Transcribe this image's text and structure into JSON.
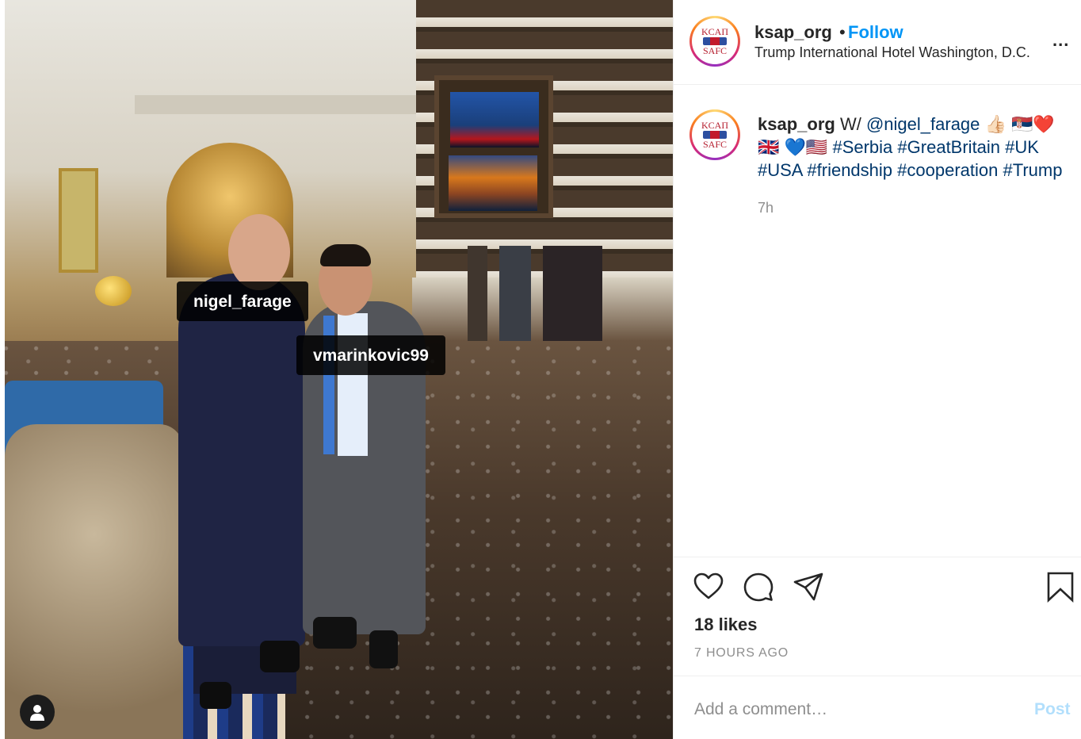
{
  "photo": {
    "tags": [
      "nigel_farage",
      "vmarinkovic99"
    ],
    "user_tag_icon": "person-icon"
  },
  "header": {
    "avatar_logo_top": "KCAΠ",
    "avatar_logo_bottom": "SAFC",
    "username": "ksap_org",
    "separator": "•",
    "follow_label": "Follow",
    "location": "Trump International Hotel Washington, D.C.",
    "more_icon": "more-options-icon",
    "more_label": "..."
  },
  "caption": {
    "username": "ksap_org",
    "text_prefix": "W/",
    "mention": "@nigel_farage",
    "emojis_1": "👍🏻 🇷🇸❤️🇬🇧",
    "emojis_2": "💙🇺🇸",
    "hashtags": [
      "#Serbia",
      "#GreatBritain",
      "#UK",
      "#USA",
      "#friendship",
      "#cooperation",
      "#Trump"
    ],
    "time": "7h"
  },
  "actions": {
    "icons": [
      "heart-icon",
      "comment-icon",
      "share-icon",
      "bookmark-icon"
    ],
    "likes": "18 likes",
    "posted": "7 HOURS AGO"
  },
  "comment": {
    "placeholder": "Add a comment…",
    "post_label": "Post"
  }
}
